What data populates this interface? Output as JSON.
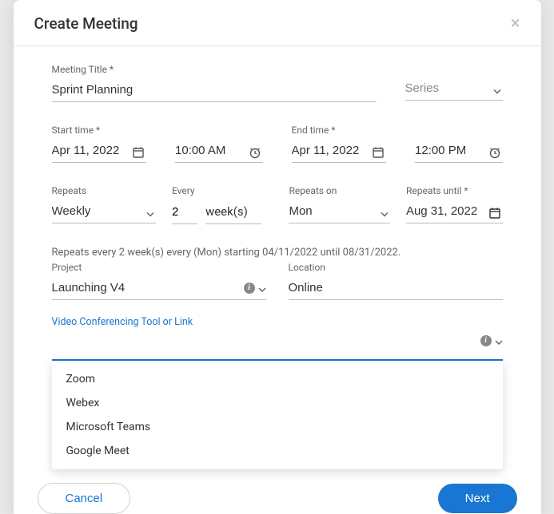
{
  "header": {
    "title": "Create Meeting"
  },
  "fields": {
    "meeting_title_label": "Meeting Title *",
    "meeting_title_value": "Sprint Planning",
    "series_label": "Series",
    "start_time_label": "Start time *",
    "start_date_value": "Apr 11, 2022",
    "start_time_value": "10:00 AM",
    "end_time_label": "End time *",
    "end_date_value": "Apr 11, 2022",
    "end_time_value": "12:00 PM",
    "repeats_label": "Repeats",
    "repeats_value": "Weekly",
    "every_label": "Every",
    "every_value": "2",
    "every_unit": "week(s)",
    "repeats_on_label": "Repeats on",
    "repeats_on_value": "Mon",
    "repeats_until_label": "Repeats until *",
    "repeats_until_value": "Aug 31, 2022",
    "summary": "Repeats every 2 week(s) every (Mon) starting 04/11/2022 until 08/31/2022.",
    "project_label": "Project",
    "project_value": "Launching V4",
    "location_label": "Location",
    "location_value": "Online",
    "conf_link_label": "Video Conferencing Tool or Link"
  },
  "dropdown_options": [
    "Zoom",
    "Webex",
    "Microsoft Teams",
    "Google Meet"
  ],
  "buttons": {
    "cancel": "Cancel",
    "next": "Next"
  }
}
